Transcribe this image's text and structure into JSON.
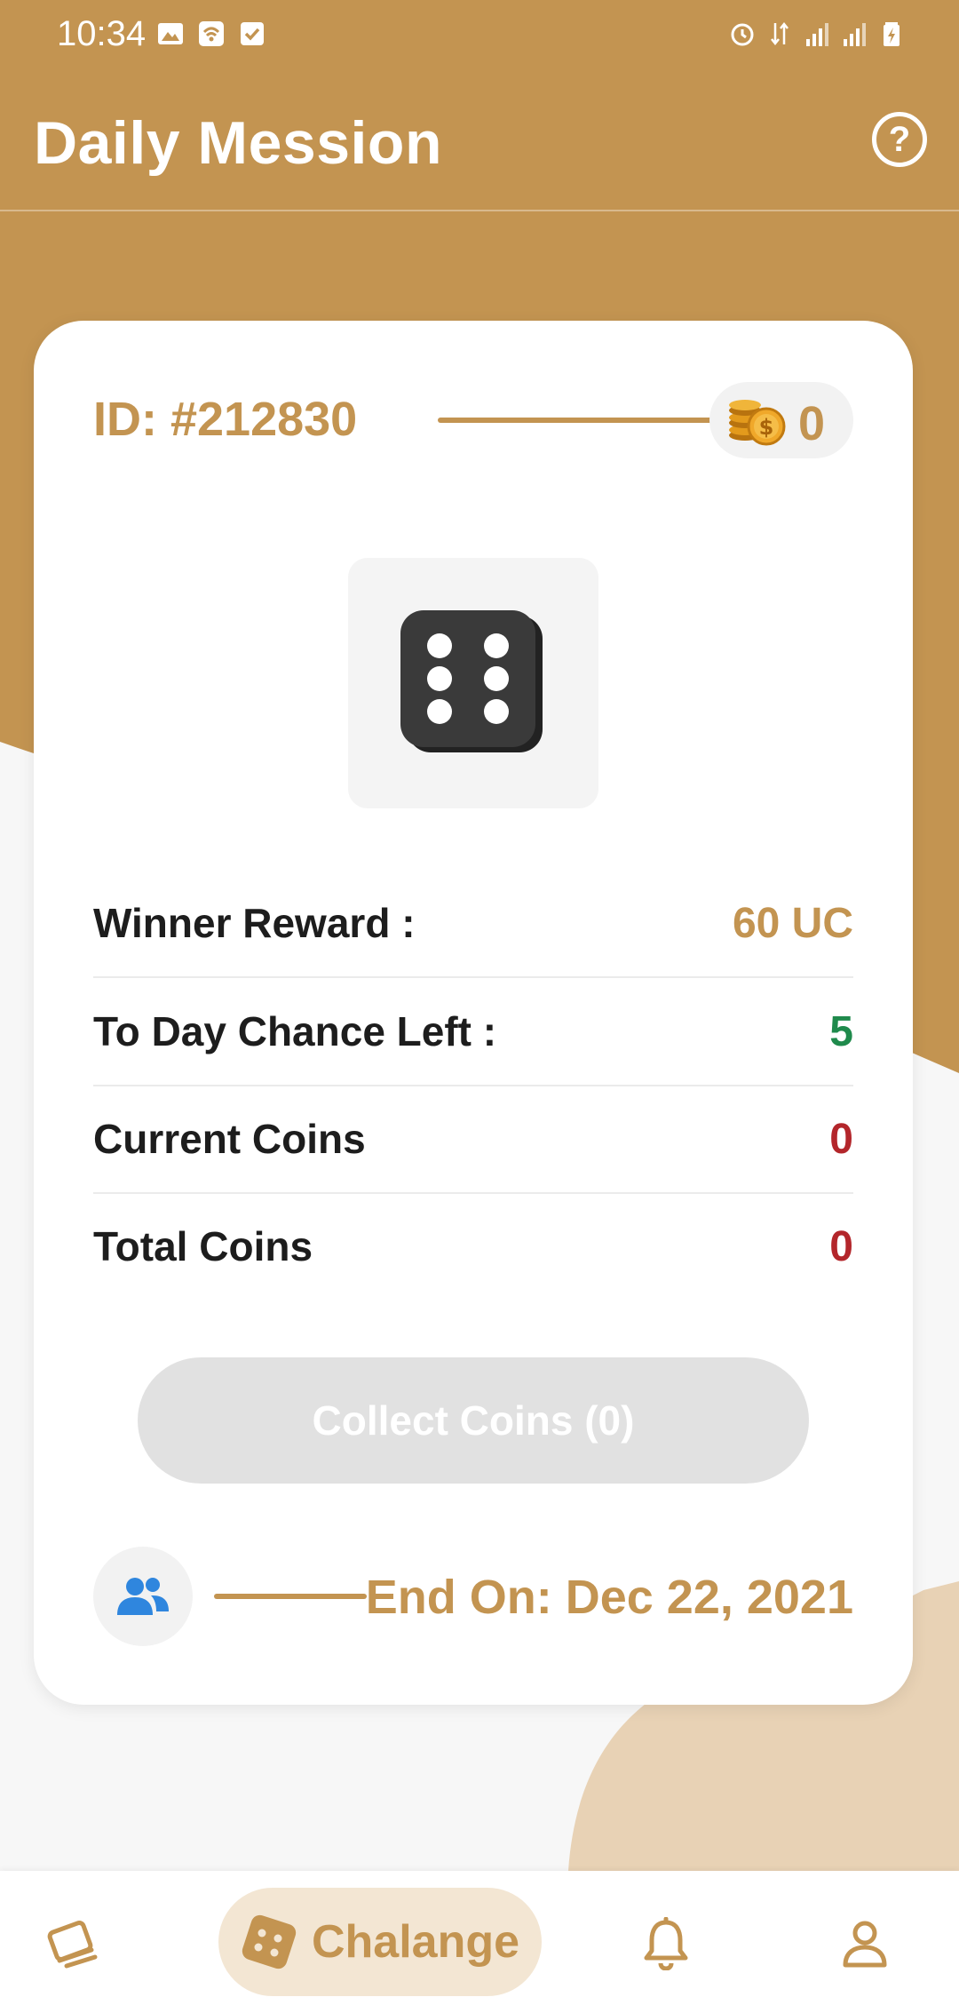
{
  "colors": {
    "brand": "#c39451",
    "brand_light": "#e8d2b5",
    "success": "#1f8a4c",
    "danger": "#b3262b",
    "disabled": "#e1e1e1"
  },
  "status_bar": {
    "time": "10:34",
    "left_icons": [
      "image-icon",
      "wifi-calling-icon",
      "check-box-icon"
    ],
    "right_icons": [
      "alarm-icon",
      "data-arrows-icon",
      "signal-icon",
      "signal-icon",
      "battery-charging-icon"
    ]
  },
  "header": {
    "title": "Daily Mession",
    "help_icon": "help-circle-icon"
  },
  "card": {
    "id_label": "ID: #212830",
    "coin_icon": "coin-stack-icon",
    "coin_count": "0",
    "dice_icon": "dice-six-icon",
    "rows": [
      {
        "label": "Winner Reward :",
        "value": "60 UC",
        "color": "#c39451"
      },
      {
        "label": "To Day Chance Left :",
        "value": "5",
        "color": "#1f8a4c"
      },
      {
        "label": "Current Coins",
        "value": "0",
        "color": "#b3262b"
      },
      {
        "label": "Total Coins",
        "value": "0",
        "color": "#b3262b"
      }
    ],
    "collect_button": "Collect Coins (0)",
    "group_icon": "group-icon",
    "end_text": "End On: Dec 22, 2021"
  },
  "bottom_nav": {
    "items": [
      {
        "icon": "cards-icon",
        "label": ""
      },
      {
        "icon": "dice-icon",
        "label": "Chalange",
        "active": true
      },
      {
        "icon": "bell-icon",
        "label": ""
      },
      {
        "icon": "user-icon",
        "label": ""
      }
    ]
  }
}
